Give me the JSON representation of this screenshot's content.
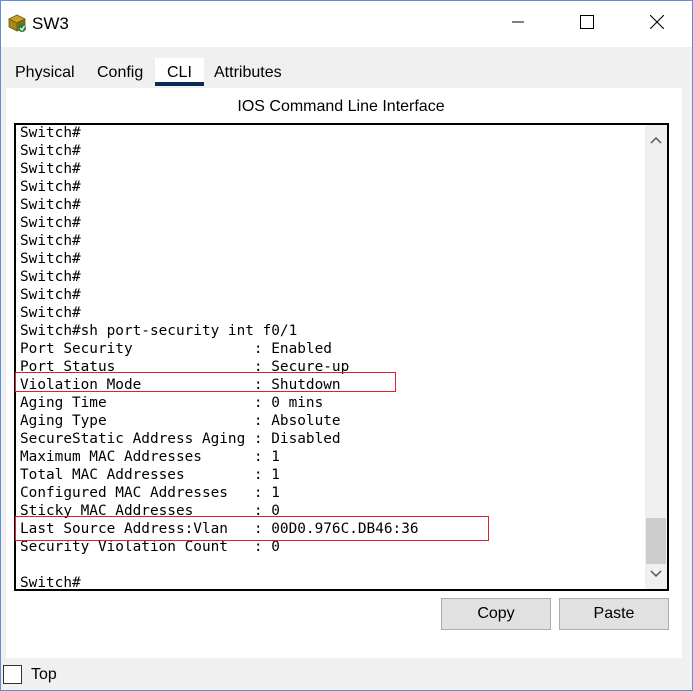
{
  "window": {
    "title": "SW3",
    "controls": {
      "minimize": "minimize",
      "maximize": "maximize",
      "close": "close"
    }
  },
  "tabs": [
    {
      "label": "Physical",
      "active": false
    },
    {
      "label": "Config",
      "active": false
    },
    {
      "label": "CLI",
      "active": true
    },
    {
      "label": "Attributes",
      "active": false
    }
  ],
  "cli": {
    "heading": "IOS Command Line Interface",
    "lines": [
      "Switch#",
      "Switch#",
      "Switch#",
      "Switch#",
      "Switch#",
      "Switch#",
      "Switch#",
      "Switch#",
      "Switch#",
      "Switch#",
      "Switch#",
      "Switch#sh port-security int f0/1",
      "Port Security              : Enabled",
      "Port Status                : Secure-up",
      "Violation Mode             : Shutdown",
      "Aging Time                 : 0 mins",
      "Aging Type                 : Absolute",
      "SecureStatic Address Aging : Disabled",
      "Maximum MAC Addresses      : 1",
      "Total MAC Addresses        : 1",
      "Configured MAC Addresses   : 1",
      "Sticky MAC Addresses       : 0",
      "Last Source Address:Vlan   : 00D0.976C.DB46:36",
      "Security Violation Count   : 0",
      "",
      "Switch#"
    ],
    "highlight_color": "#e0202a"
  },
  "buttons": {
    "copy": "Copy",
    "paste": "Paste"
  },
  "footer": {
    "top_label": "Top",
    "top_checked": false
  },
  "colors": {
    "active_tab_underline": "#0a2a56",
    "window_border": "#5c8fd6"
  }
}
